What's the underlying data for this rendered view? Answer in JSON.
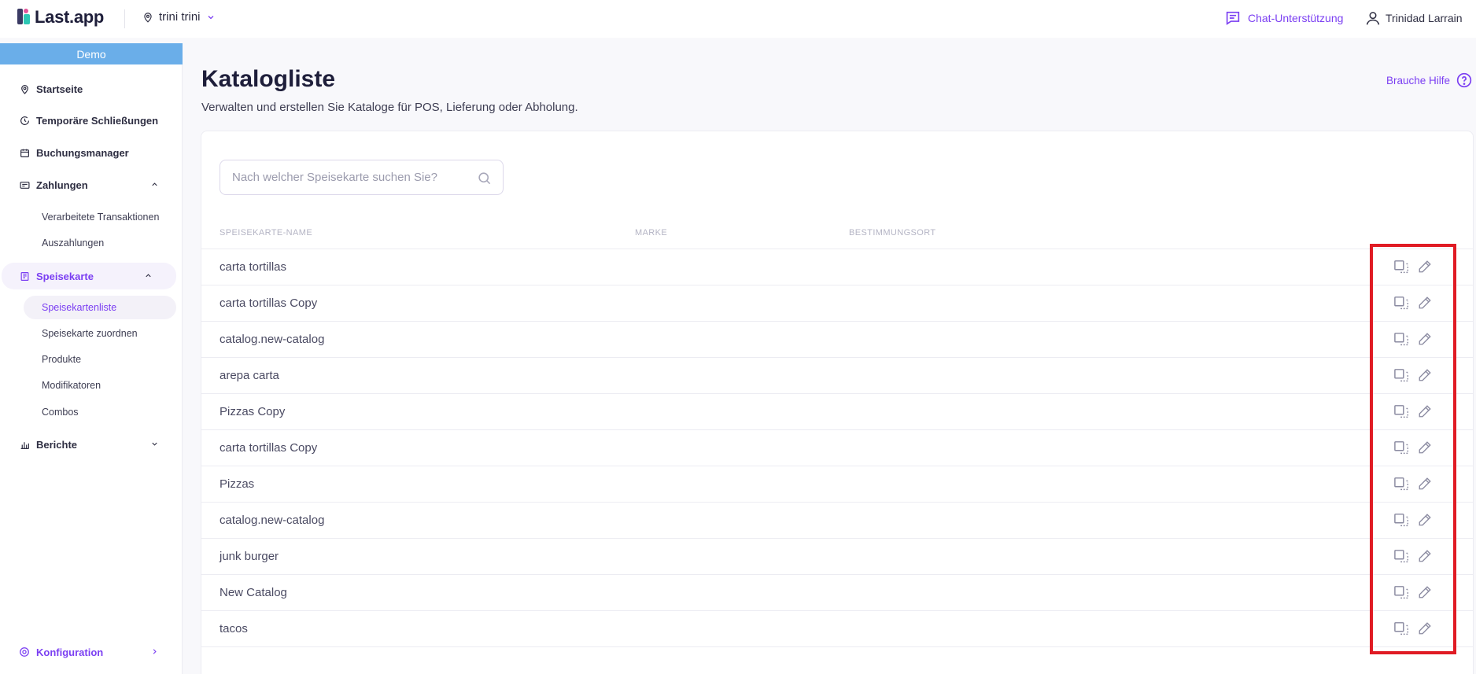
{
  "app": {
    "logo_text": "Last.app"
  },
  "header": {
    "location": "trini trini",
    "chat_label": "Chat-Unterstützung",
    "user_name": "Trinidad Larrain"
  },
  "sidebar": {
    "demo_label": "Demo",
    "items": [
      {
        "label": "Startseite",
        "icon": "map-pin-icon"
      },
      {
        "label": "Temporäre Schließungen",
        "icon": "clock-icon"
      },
      {
        "label": "Buchungsmanager",
        "icon": "calendar-icon"
      },
      {
        "label": "Zahlungen",
        "icon": "payment-icon",
        "expanded": true
      },
      {
        "label": "Speisekarte",
        "icon": "menu-book-icon",
        "expanded": true,
        "active": true
      },
      {
        "label": "Berichte",
        "icon": "bar-chart-icon",
        "expanded": false
      }
    ],
    "zahlungen_sub": [
      "Verarbeitete Transaktionen",
      "Auszahlungen"
    ],
    "speisekarte_sub": [
      "Speisekartenliste",
      "Speisekarte zuordnen",
      "Produkte",
      "Modifikatoren",
      "Combos"
    ],
    "config_label": "Konfiguration"
  },
  "main": {
    "title": "Katalogliste",
    "subtitle": "Verwalten und erstellen Sie Kataloge für POS, Lieferung oder Abholung.",
    "help_label": "Brauche Hilfe",
    "search_placeholder": "Nach welcher Speisekarte suchen Sie?",
    "columns": [
      "SPEISEKARTE-NAME",
      "MARKE",
      "BESTIMMUNGSORT"
    ],
    "rows": [
      "carta tortillas",
      "carta tortillas Copy",
      "catalog.new-catalog",
      "arepa carta",
      "Pizzas Copy",
      "carta tortillas Copy",
      "Pizzas",
      "catalog.new-catalog",
      "junk burger",
      "New Catalog",
      "tacos"
    ]
  },
  "colors": {
    "accent": "#7b3ff2",
    "demo_bar": "#6aaee9",
    "highlight": "#e01b24"
  }
}
